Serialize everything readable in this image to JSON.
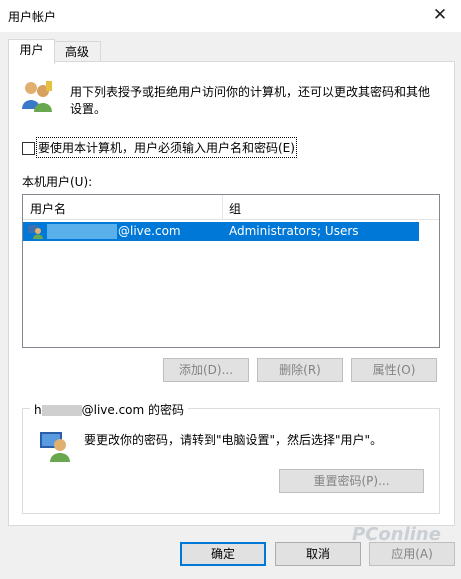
{
  "window": {
    "title": "用户帐户"
  },
  "tabs": [
    {
      "label": "用户",
      "active": true
    },
    {
      "label": "高级",
      "active": false
    }
  ],
  "intro_text_line1": "用下列表授予或拒绝用户访问你的计算机，还可以更改其密码和其他",
  "intro_text_line2": "设置。",
  "require_login_checkbox": {
    "label": "要使用本计算机，用户必须输入用户名和密码(E)",
    "checked": false
  },
  "users_section_label": "本机用户(U):",
  "users_table": {
    "columns": [
      "用户名",
      "组"
    ],
    "rows": [
      {
        "username": "@live.com",
        "group": "Administrators; Users",
        "selected": true
      }
    ]
  },
  "buttons": {
    "add": "添加(D)...",
    "remove": "删除(R)",
    "properties": "属性(O)"
  },
  "password_group": {
    "title_prefix": "h",
    "title_suffix": "@live.com 的密码",
    "message": "要更改你的密码，请转到\"电脑设置\"，然后选择\"用户\"。",
    "reset_button": "重置密码(P)..."
  },
  "dialog_buttons": {
    "ok": "确定",
    "cancel": "取消",
    "apply": "应用(A)"
  },
  "watermark": "PConline",
  "colors": {
    "selection": "#0078d7",
    "default_border": "#0078d7"
  }
}
